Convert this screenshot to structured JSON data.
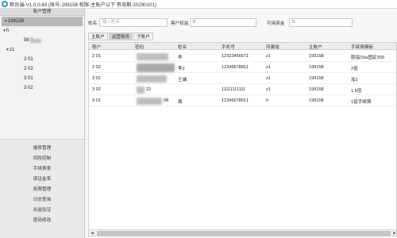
{
  "titlebar": {
    "title": "柜台端-V1.0.0.63 (账号-199158 权限-主账户以下 有效期-20290101)"
  },
  "sidebar": {
    "tree_header": "账户管理",
    "tree": [
      {
        "label": "199158",
        "level": 0,
        "twisty": "▼",
        "selected": true
      },
      {
        "label": "h",
        "level": 1,
        "twisty": "▼"
      },
      {
        "label": "98      1",
        "level": 2,
        "twisty": ""
      },
      {
        "label": "z1",
        "level": 1,
        "twisty": "▼"
      },
      {
        "label": "2         01",
        "level": 2,
        "twisty": ""
      },
      {
        "label": "2         02",
        "level": 2,
        "twisty": ""
      },
      {
        "label": "3         01",
        "level": 2,
        "twisty": ""
      },
      {
        "label": "3         02",
        "level": 2,
        "twisty": ""
      }
    ],
    "menu": [
      "报表管理",
      "风险控制",
      "手续费率",
      "保证金率",
      "权限管理",
      "日志查询",
      "出金验证",
      "密码修改"
    ]
  },
  "filters": {
    "name_label": "姓名",
    "name_placeholder": "输入姓名",
    "equity_label": "客户权益",
    "equity_value": "0",
    "avail_label": "可用资金",
    "avail_value": "0"
  },
  "tabs": [
    "主账户",
    "运营账员",
    "子账户"
  ],
  "table": {
    "columns": [
      "账户",
      "密码",
      "姓名",
      "手机号",
      "所属组",
      "主账户",
      "手续费模板"
    ],
    "rows": [
      [
        "2         01",
        "",
        "李",
        "12323456671",
        "z1",
        "199158",
        "股指15w固定300"
      ],
      [
        "2         02",
        "",
        "李2",
        "12345678911",
        "z1",
        "199158",
        "2倍"
      ],
      [
        "3         01",
        "",
        "王端",
        "",
        "z1",
        "199158",
        "加1"
      ],
      [
        "3         02",
        "22",
        "",
        "11111111111",
        "z1",
        "199158",
        "1.5倍"
      ],
      [
        "9         01",
        "08",
        "周",
        "12345678911",
        "h",
        "199158",
        "1倍手续费"
      ]
    ],
    "scroll_left": "◀",
    "scroll_right": "▶"
  }
}
